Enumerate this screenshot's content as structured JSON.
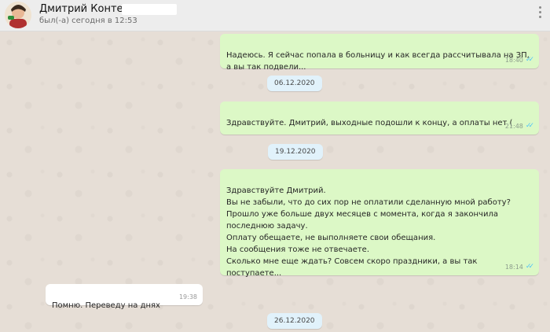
{
  "header": {
    "contact_name": "Дмитрий Контент",
    "status": "был(-а) сегодня в 12:53",
    "menu_icon": "more-vertical-icon",
    "avatar_icon": "avatar"
  },
  "messages": [
    {
      "type": "out",
      "text": "Надеюсь. Я сейчас попала в больницу и как всегда рассчитывала на ЗП, а вы так подвели...",
      "time": "18:40",
      "status_icon": "double-check-read-icon"
    },
    {
      "type": "date",
      "text": "06.12.2020"
    },
    {
      "type": "out",
      "text": "Здравствуйте. Дмитрий, выходные подошли к концу, а оплаты нет (",
      "time": "21:48",
      "status_icon": "double-check-read-icon"
    },
    {
      "type": "date",
      "text": "19.12.2020"
    },
    {
      "type": "out",
      "text": "Здравствуйте Дмитрий.\nВы не забыли, что до сих пор не оплатили сделанную мной работу?\nПрошло уже больше двух месяцев с момента, когда я закончила последнюю задачу.\nОплату обещаете, не выполняете свои обещания.\nНа сообщения тоже не отвечаете.\nСколько мне еще ждать? Совсем скоро праздники, а вы так поступаете...",
      "time": "18:14",
      "status_icon": "double-check-read-icon"
    },
    {
      "type": "in",
      "text": "Помню. Переведу на днях",
      "time": "19:38"
    },
    {
      "type": "date",
      "text": "26.12.2020"
    }
  ],
  "colors": {
    "outgoing_bubble": "#dcf8c6",
    "incoming_bubble": "#ffffff",
    "date_chip": "#e1f2fb",
    "read_check": "#4fc3f7"
  }
}
